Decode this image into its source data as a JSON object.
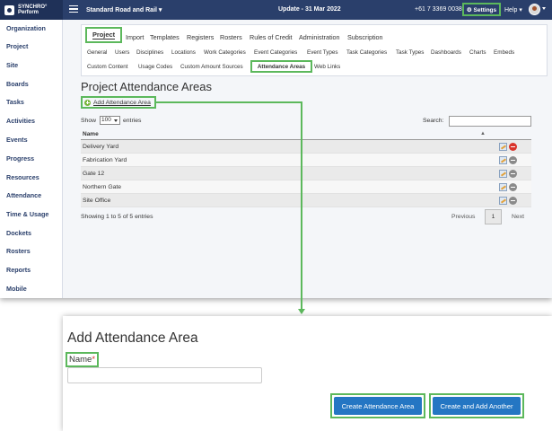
{
  "app": {
    "logo_text": "SYNCHRO° Perform",
    "logo_line1": "SYNCHRO°",
    "logo_line2": "Perform",
    "org_name": "Standard Road and Rail ▾",
    "update_text": "Update - 31 Mar 2022",
    "phone": "+61 7 3369 0038",
    "settings_label": "⚙ Settings",
    "help_label": "Help ▾"
  },
  "sidebar": {
    "items": [
      {
        "label": "Organization"
      },
      {
        "label": "Project"
      },
      {
        "label": "Site"
      },
      {
        "label": "Boards"
      },
      {
        "label": "Tasks"
      },
      {
        "label": "Activities"
      },
      {
        "label": "Events"
      },
      {
        "label": "Progress"
      },
      {
        "label": "Resources"
      },
      {
        "label": "Attendance"
      },
      {
        "label": "Time & Usage"
      },
      {
        "label": "Dockets"
      },
      {
        "label": "Rosters"
      },
      {
        "label": "Reports"
      },
      {
        "label": "Mobile"
      }
    ]
  },
  "tabs": {
    "main": [
      {
        "label": "Project"
      },
      {
        "label": "Import"
      },
      {
        "label": "Templates"
      },
      {
        "label": "Registers"
      },
      {
        "label": "Rosters"
      },
      {
        "label": "Rules of Credit"
      },
      {
        "label": "Administration"
      },
      {
        "label": "Subscription"
      }
    ],
    "sub_row1": [
      {
        "label": "General"
      },
      {
        "label": "Users"
      },
      {
        "label": "Disciplines"
      },
      {
        "label": "Locations"
      },
      {
        "label": "Work Categories"
      },
      {
        "label": "Event Categories"
      },
      {
        "label": "Event Types"
      },
      {
        "label": "Task Categories"
      },
      {
        "label": "Task Types"
      },
      {
        "label": "Dashboards"
      },
      {
        "label": "Charts"
      },
      {
        "label": "Embeds"
      }
    ],
    "sub_row2": [
      {
        "label": "Custom Content"
      },
      {
        "label": "Usage Codes"
      },
      {
        "label": "Custom Amount Sources"
      },
      {
        "label": "Attendance Areas"
      },
      {
        "label": "Web Links"
      }
    ]
  },
  "page": {
    "title": "Project Attendance Areas",
    "add_link": "Add Attendance Area",
    "show_label": "Show",
    "show_value": "100",
    "entries_label": "entries",
    "search_label": "Search:",
    "search_value": ""
  },
  "table": {
    "column": "Name",
    "sort_indicator": "▲",
    "rows": [
      {
        "name": "Delivery Yard",
        "delete_color": "#d9342b"
      },
      {
        "name": "Fabrication Yard",
        "delete_color": "#8a8a8a"
      },
      {
        "name": "Gate 12",
        "delete_color": "#8a8a8a"
      },
      {
        "name": "Northern Gate",
        "delete_color": "#8a8a8a"
      },
      {
        "name": "Site Office",
        "delete_color": "#8a8a8a"
      }
    ],
    "showing": "Showing 1 to 5 of 5 entries",
    "prev": "Previous",
    "page": "1",
    "next": "Next"
  },
  "modal": {
    "title": "Add Attendance Area",
    "name_label": "Name",
    "required_mark": "*",
    "name_value": "",
    "create_label": "Create Attendance Area",
    "create_another_label": "Create and Add Another"
  },
  "colors": {
    "topbar": "#2a3f6b",
    "highlight": "#5cb85c",
    "primary_button": "#2476c3",
    "add_icon": "#78b63b"
  }
}
